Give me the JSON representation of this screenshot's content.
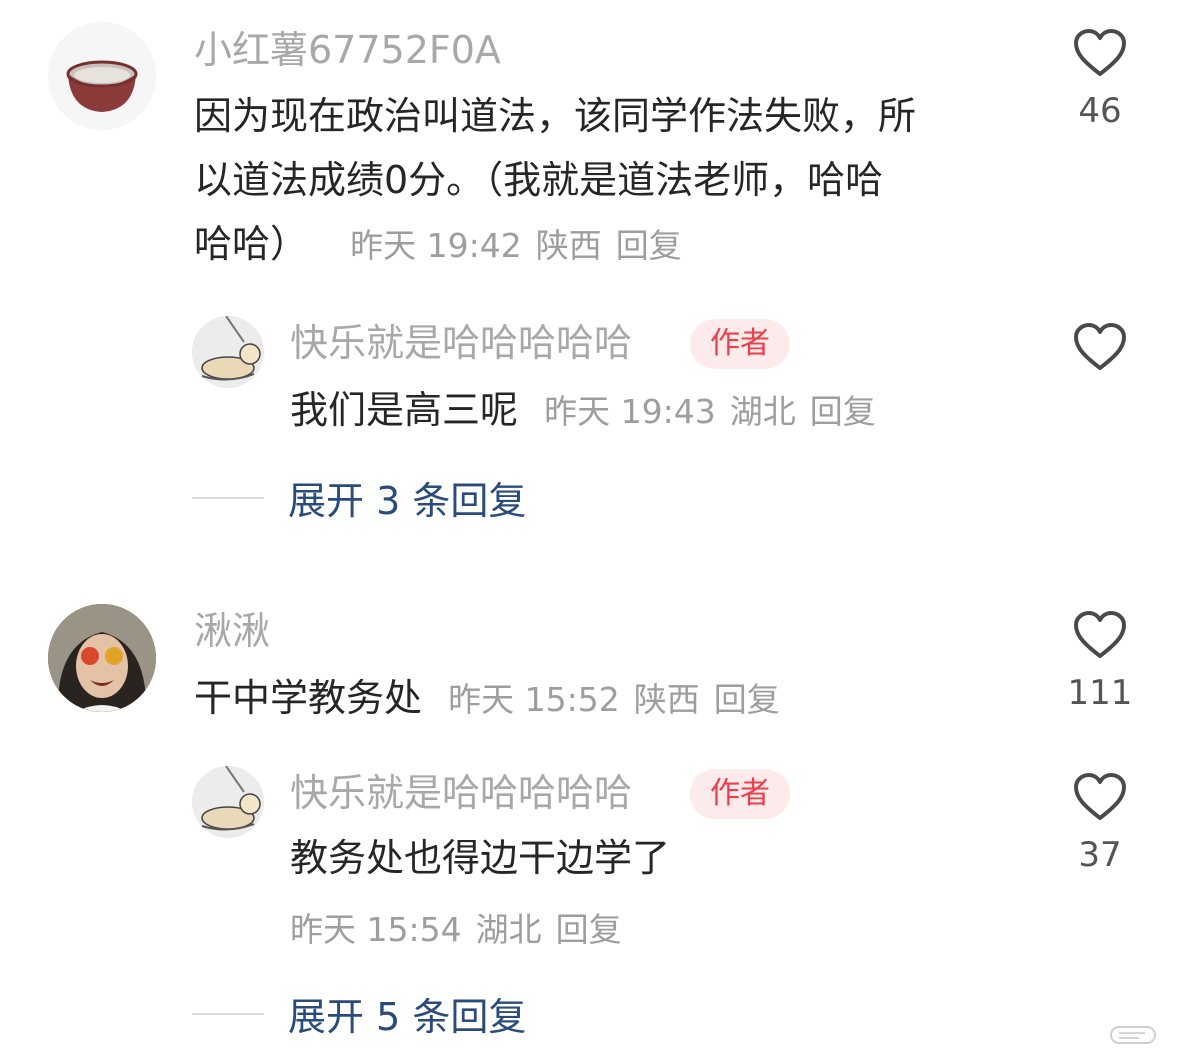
{
  "comments": [
    {
      "username": "小红薯67752F0A",
      "content_lines": [
        "因为现在政治叫道法，该同学作法失败，所",
        "以道法成绩0分。（我就是道法老师，哈哈",
        "哈哈）"
      ],
      "time": "昨天 19:42",
      "location": "陕西",
      "reply_label": "回复",
      "likes": "46",
      "avatar_icon": "bowl-avatar"
    },
    {
      "username": "快乐就是哈哈哈哈哈",
      "badge": "作者",
      "content": "我们是高三呢",
      "time": "昨天 19:43",
      "location": "湖北",
      "reply_label": "回复",
      "likes": "",
      "avatar_icon": "sleeping-person-avatar"
    },
    {
      "expand_label": "展开 3 条回复"
    },
    {
      "username": "湫湫",
      "content": "干中学教务处",
      "time": "昨天 15:52",
      "location": "陕西",
      "reply_label": "回复",
      "likes": "111",
      "avatar_icon": "girl-avatar"
    },
    {
      "username": "快乐就是哈哈哈哈哈",
      "badge": "作者",
      "content": "教务处也得边干边学了",
      "time": "昨天 15:54",
      "location": "湖北",
      "reply_label": "回复",
      "likes": "37",
      "avatar_icon": "sleeping-person-avatar"
    },
    {
      "expand_label": "展开 5 条回复"
    }
  ],
  "colors": {
    "username": "#a8a8a8",
    "content": "#262626",
    "meta": "#9e9e9e",
    "badge_bg": "#fdeaea",
    "badge_text": "#ee3d4b",
    "expand_text": "#2a4c7d"
  }
}
